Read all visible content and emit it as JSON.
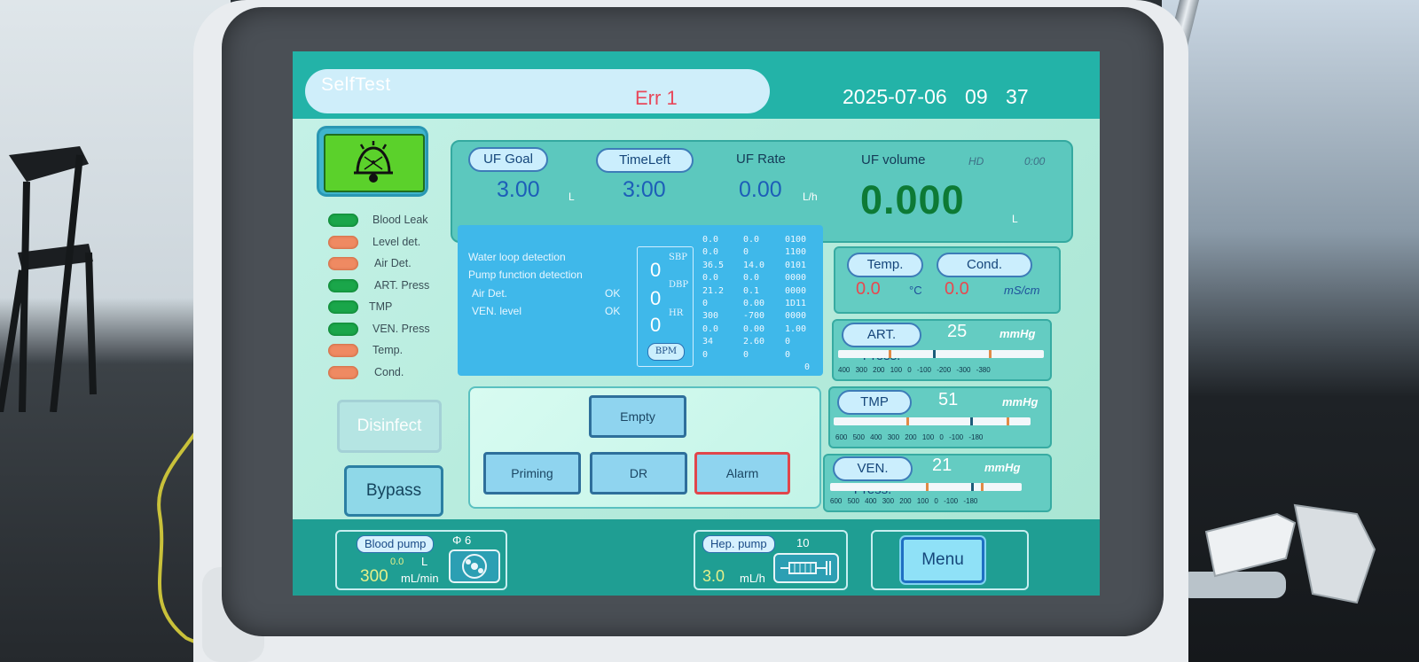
{
  "header": {
    "title": "SelfTest",
    "error": "Err 1",
    "date": "2025-07-06",
    "hour": "09",
    "minute": "37"
  },
  "leds": [
    {
      "label": "Blood Leak",
      "color": "green"
    },
    {
      "label": "Level det.",
      "color": "orange"
    },
    {
      "label": "Air Det.",
      "color": "orange"
    },
    {
      "label": "ART. Press",
      "color": "green"
    },
    {
      "label": "TMP",
      "color": "green"
    },
    {
      "label": "VEN. Press",
      "color": "green"
    },
    {
      "label": "Temp.",
      "color": "orange"
    },
    {
      "label": "Cond.",
      "color": "orange"
    }
  ],
  "side_buttons": {
    "disinfect": "Disinfect",
    "bypass": "Bypass"
  },
  "uf": {
    "goal_label": "UF Goal",
    "goal_value": "3.00",
    "goal_unit": "L",
    "timeleft_label": "TimeLeft",
    "timeleft_value": "3:00",
    "rate_label": "UF Rate",
    "rate_value": "0.00",
    "rate_unit": "L/h",
    "volume_label": "UF volume",
    "volume_value": "0.000",
    "volume_unit": "L",
    "mode": "HD",
    "mode_time": "0:00"
  },
  "detection": {
    "lines": [
      {
        "label": "Water loop detection",
        "status": ""
      },
      {
        "label": "Pump function detection",
        "status": ""
      },
      {
        "label": "Air Det.",
        "status": "OK"
      },
      {
        "label": "VEN. level",
        "status": "OK"
      }
    ],
    "sbp_label": "SBP",
    "dbp_label": "DBP",
    "hr_label": "HR",
    "sbp": "0",
    "dbp": "0",
    "hr": "0",
    "bpm_label": "BPM"
  },
  "grid": [
    [
      "0.0",
      "0.0",
      "0100"
    ],
    [
      "0.0",
      "0",
      "1100"
    ],
    [
      "36.5",
      "14.0",
      "0101"
    ],
    [
      "0.0",
      "0.0",
      "0000"
    ],
    [
      "21.2",
      "0.1",
      "0000"
    ],
    [
      "0",
      "0.00",
      "1D11"
    ],
    [
      "300",
      "-700",
      "0000"
    ],
    [
      "0.0",
      "0.00",
      "1.00"
    ],
    [
      "34",
      "2.60",
      "0"
    ],
    [
      "0",
      "0",
      "0"
    ]
  ],
  "grid_extra_last": "0",
  "temp_cond": {
    "temp_label": "Temp.",
    "temp_value": "0.0",
    "temp_unit": "°C",
    "cond_label": "Cond.",
    "cond_value": "0.0",
    "cond_unit": "mS/cm"
  },
  "pressures": [
    {
      "label": "ART. Press.",
      "value": "25",
      "unit": "mmHg",
      "ticks": "400 300 200 100 0 -100 -200 -300 -380"
    },
    {
      "label": "TMP",
      "value": "51",
      "unit": "mmHg",
      "ticks": "600 500 400 300 200 100 0 -100 -180"
    },
    {
      "label": "VEN. Press.",
      "value": "21",
      "unit": "mmHg",
      "ticks": "600 500 400 300 200 100 0 -100 -180"
    }
  ],
  "controls": {
    "empty": "Empty",
    "priming": "Priming",
    "dr": "DR",
    "alarm": "Alarm"
  },
  "bottom": {
    "blood_pump_label": "Blood pump",
    "blood_pump_phi": "Φ 6",
    "blood_volume": "0.0",
    "blood_volume_unit": "L",
    "blood_rate": "300",
    "blood_rate_unit": "mL/min",
    "hep_pump_label": "Hep. pump",
    "hep_pump_number": "10",
    "hep_rate": "3.0",
    "hep_rate_unit": "mL/h",
    "menu": "Menu"
  },
  "colors": {
    "green_led": "#1aa64a",
    "orange_led": "#ef8a62",
    "alarm_red": "#e0464b",
    "topbar": "#23b3a8"
  }
}
